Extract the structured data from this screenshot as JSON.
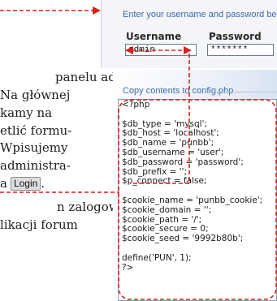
{
  "article": {
    "lines": [
      "panelu ad-",
      "Na głównej",
      "kamy na",
      "etlić formu-",
      "Wpisujemy",
      "administra-",
      "a",
      "n zalogowa-",
      "likacji forum"
    ],
    "login_chip": "Login"
  },
  "login_form": {
    "caption": "Enter your username and password below",
    "username_label": "Username",
    "password_label": "Password",
    "username_value": "admin",
    "password_value": "*******"
  },
  "config": {
    "caption": "Copy contents to config.php",
    "code": "<?php\n\n$db_type = 'mysql';\n$db_host = 'localhost';\n$db_name = 'punbb';\n$db_username = 'user';\n$db_password = 'password';\n$db_prefix = '';\n$p_connect = false;\n\n$cookie_name = 'punbb_cookie';\n$cookie_domain = '';\n$cookie_path = '/';\n$cookie_secure = 0;\n$cookie_seed = '9992b80b';\n\ndefine('PUN', 1);\n?>"
  },
  "colors": {
    "callout": "#d62020",
    "caption": "#3c6aa5"
  }
}
